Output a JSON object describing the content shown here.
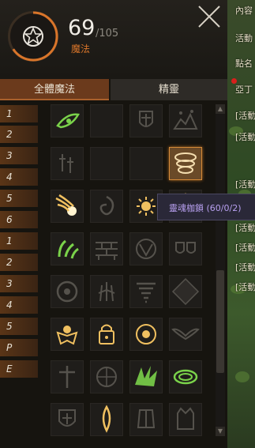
{
  "header": {
    "mp_current": "69",
    "mp_max": "/105",
    "mp_label": "魔法"
  },
  "tabs": [
    {
      "label": "全體魔法",
      "active": true
    },
    {
      "label": "精靈",
      "active": false
    }
  ],
  "levels": [
    "1",
    "2",
    "3",
    "4",
    "5",
    "6",
    "1",
    "2",
    "3",
    "4",
    "5",
    "P",
    "E"
  ],
  "tooltip": {
    "text": "靈魂枷鎖 (60/0/2)"
  },
  "right_panel": [
    "內容",
    "活動",
    "點名",
    "亞丁",
    "[活動",
    "[活動",
    "[活動",
    "[活動",
    "[活動",
    "[活動",
    "[活動",
    "[活動"
  ],
  "skills": [
    [
      "green-eye-icon",
      "empty",
      "shield-cross-icon",
      "rock-shatter-icon"
    ],
    [
      "sword-down-icon",
      "empty",
      "empty",
      "spirit-chain-icon"
    ],
    [
      "fire-comet-icon",
      "swirl-icon",
      "sun-orb-icon",
      "star-burst-icon"
    ],
    [
      "green-leaf-icon",
      "brick-wall-icon",
      "skull-rune-icon",
      "twin-shields-icon"
    ],
    [
      "eye-ring-icon",
      "feather-hands-icon",
      "tornado-icon",
      "diamond-burst-icon"
    ],
    [
      "golden-guardian-icon",
      "locked-chest-icon",
      "radiant-orb-icon",
      "wings-icon"
    ],
    [
      "cross-blade-icon",
      "compass-icon",
      "green-spike-icon",
      "green-whirl-icon"
    ],
    [
      "armor-shield-icon",
      "golden-blade-icon",
      "dark-armor-icon",
      "crown-pillar-icon"
    ]
  ],
  "colors": {
    "accent": "#d9752a",
    "tab_active": "#6b3a1c",
    "tooltip_text": "#b8a0f0",
    "lit_green": "#7ad24a",
    "lit_gold": "#f0c060"
  }
}
